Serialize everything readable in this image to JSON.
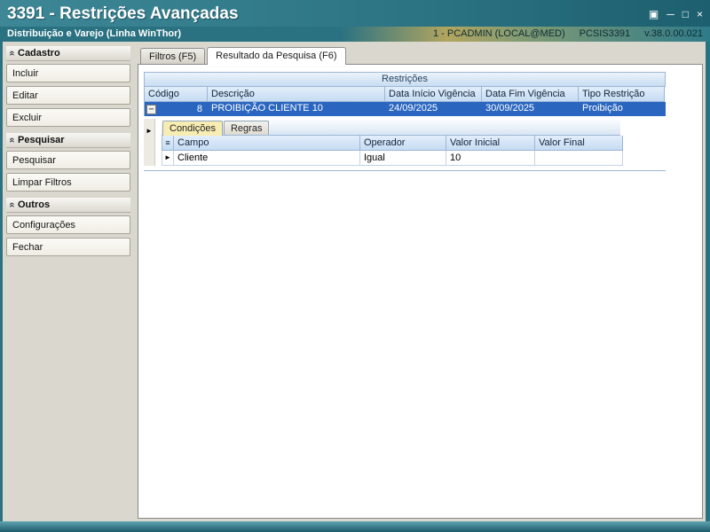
{
  "titlebar": {
    "title": "3391 - Restrições Avançadas"
  },
  "infobar": {
    "subtitle": "Distribuição e Varejo (Linha WinThor)",
    "session": "1 - PCADMIN (LOCAL@MED)",
    "product": "PCSIS3391",
    "version": "v.38.0.00.021"
  },
  "icons": {
    "restore": "▣",
    "minimize": "─",
    "maximize": "□",
    "close": "×",
    "group_collapse": "»",
    "expand_minus": "−",
    "row_indicator": "►",
    "grid_menu": "≡"
  },
  "sidebar": {
    "groups": [
      {
        "label": "Cadastro",
        "items": [
          "Incluir",
          "Editar",
          "Excluir"
        ]
      },
      {
        "label": "Pesquisar",
        "items": [
          "Pesquisar",
          "Limpar Filtros"
        ]
      },
      {
        "label": "Outros",
        "items": [
          "Configurações",
          "Fechar"
        ]
      }
    ]
  },
  "tabs": [
    {
      "label": "Filtros (F5)",
      "active": false
    },
    {
      "label": "Resultado da Pesquisa (F6)",
      "active": true
    }
  ],
  "grid": {
    "band": "Restrições",
    "columns": [
      "Código",
      "Descrição",
      "Data Início Vigência",
      "Data Fim Vigência",
      "Tipo Restrição"
    ],
    "rows": [
      {
        "codigo": "8",
        "descricao": "PROIBIÇÃO CLIENTE 10",
        "data_inicio": "24/09/2025",
        "data_fim": "30/09/2025",
        "tipo": "Proibição"
      }
    ]
  },
  "detail": {
    "tabs": [
      {
        "label": "Condições",
        "active": true
      },
      {
        "label": "Regras",
        "active": false
      }
    ],
    "columns": [
      "Campo",
      "Operador",
      "Valor Inicial",
      "Valor Final"
    ],
    "rows": [
      {
        "campo": "Cliente",
        "operador": "Igual",
        "valor_inicial": "10",
        "valor_final": ""
      }
    ]
  },
  "colors": {
    "titlebar_teal": "#2a7282",
    "selected_row_blue": "#2a66c0",
    "header_blue": "#c6dcf3",
    "active_subtab_yellow": "#f7edb3"
  }
}
